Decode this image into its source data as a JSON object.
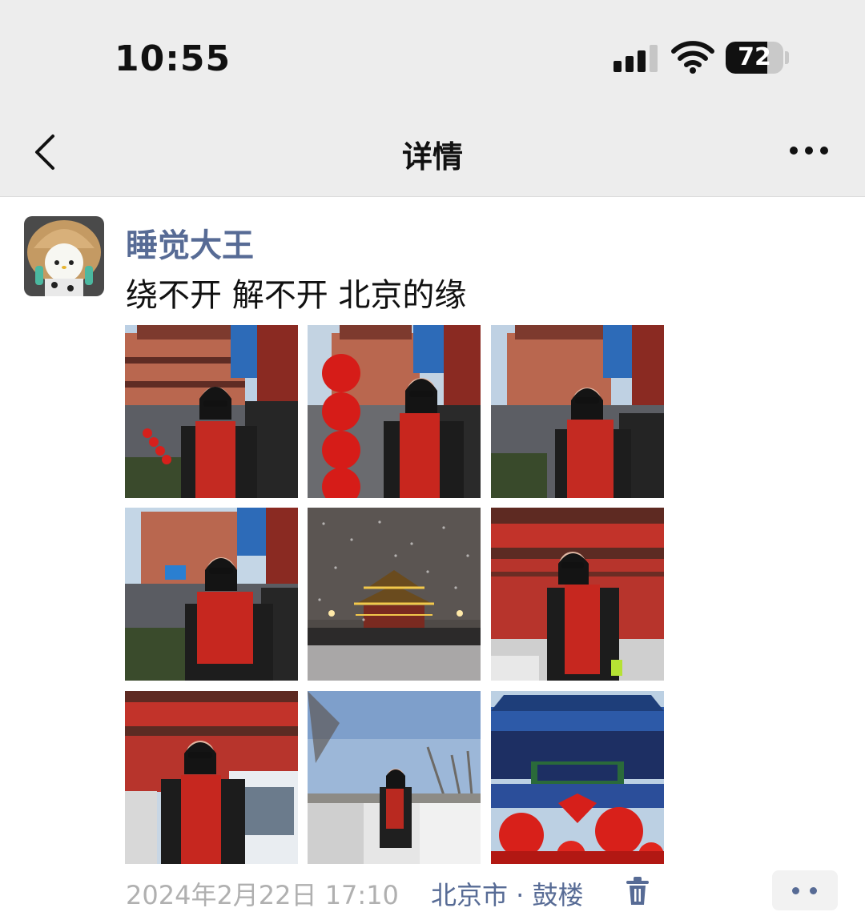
{
  "status_bar": {
    "time": "10:55",
    "battery_level": "72",
    "battery_fraction": 0.72,
    "signal_bars_active": 3,
    "signal_bars_total": 4
  },
  "nav": {
    "title": "详情",
    "back_icon": "chevron-left-icon",
    "more_icon": "more-icon"
  },
  "post": {
    "username": "睡觉大王",
    "text": "绕不开 解不开 北京的缘",
    "timestamp": "2024年2月22日 17:10",
    "location": "北京市 · 鼓楼",
    "delete_icon": "trash-icon",
    "action_icon": "more-dots-icon"
  },
  "colors": {
    "link_blue": "#576b95",
    "nav_bg": "#ededed",
    "muted_text": "#b0b0b0"
  }
}
